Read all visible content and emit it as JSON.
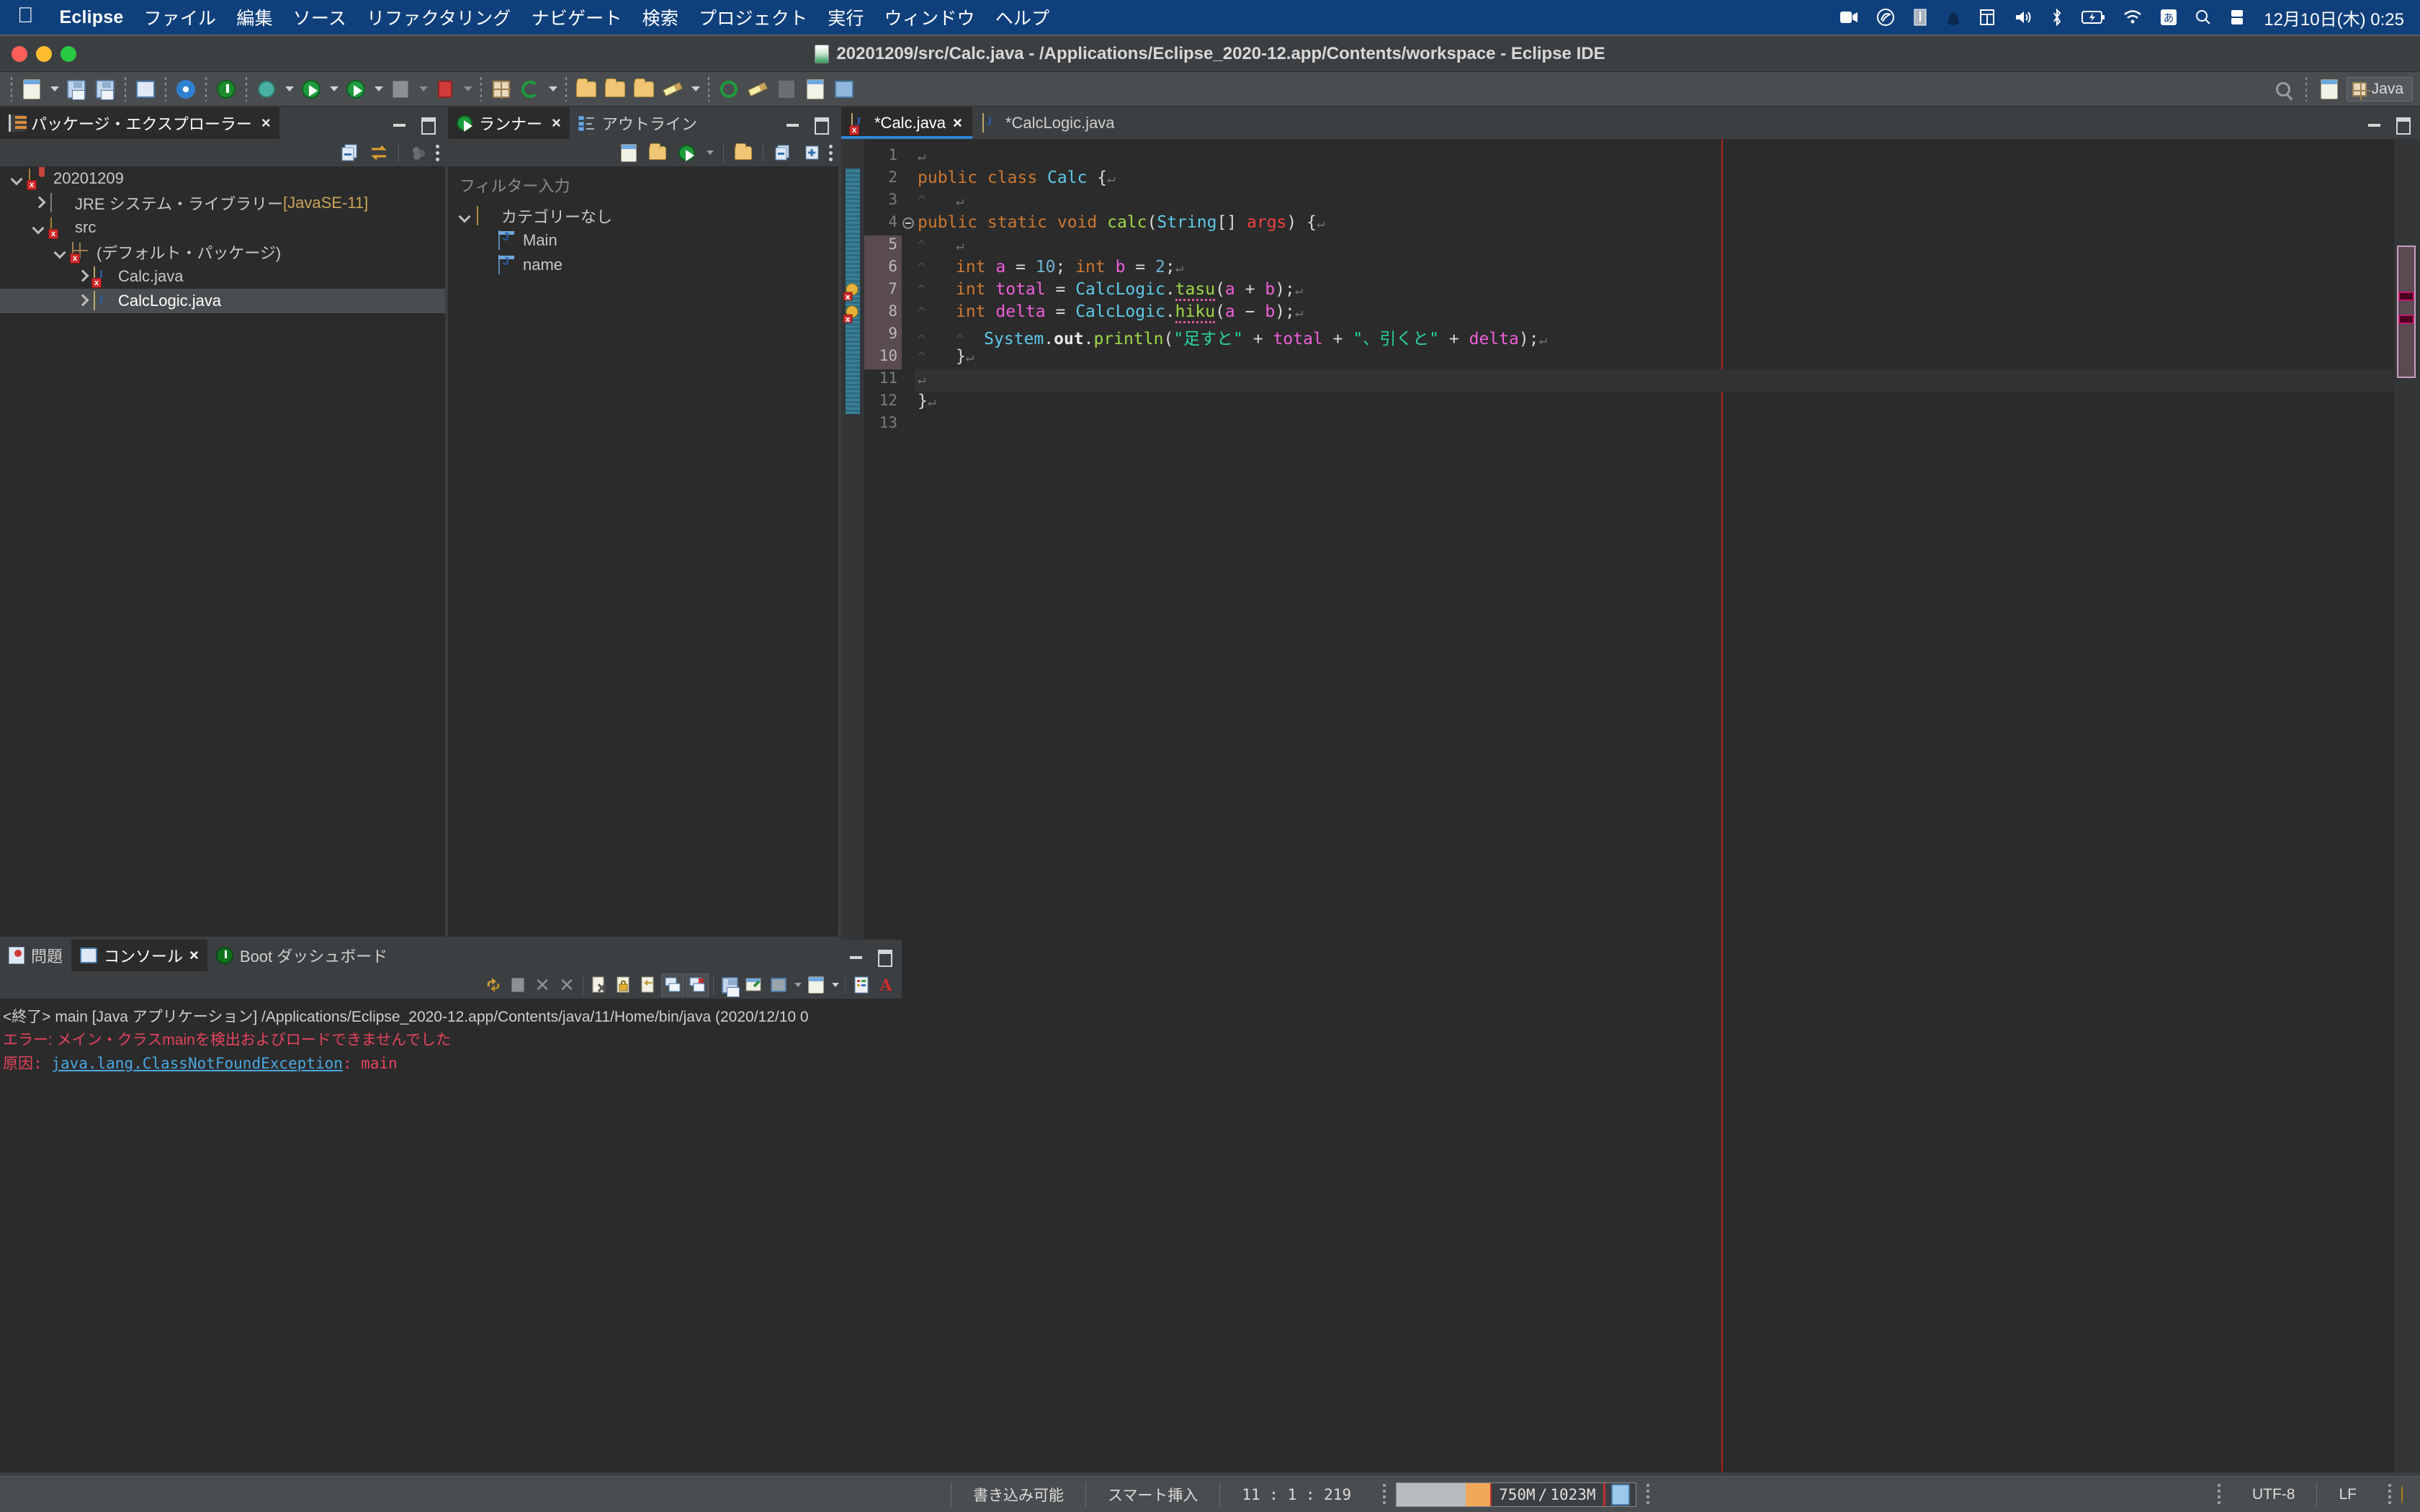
{
  "macbar": {
    "apple_icon": "apple-logo-icon",
    "menus": [
      {
        "label": "Eclipse",
        "bold": true
      },
      {
        "label": "ファイル",
        "bold": false
      },
      {
        "label": "編集",
        "bold": false
      },
      {
        "label": "ソース",
        "bold": false
      },
      {
        "label": "リファクタリング",
        "bold": false
      },
      {
        "label": "ナビゲート",
        "bold": false
      },
      {
        "label": "検索",
        "bold": false
      },
      {
        "label": "プロジェクト",
        "bold": false
      },
      {
        "label": "実行",
        "bold": false
      },
      {
        "label": "ウィンドウ",
        "bold": false
      },
      {
        "label": "ヘルプ",
        "bold": false
      }
    ],
    "tray_icons": [
      "screen-recording-icon",
      "nvidia-icon",
      "display-icon",
      "dropbox-icon",
      "window-manager-icon",
      "volume-icon",
      "bluetooth-icon",
      "battery-charging-icon",
      "wifi-icon",
      "input-method-icon",
      "spotlight-search-icon",
      "control-center-icon"
    ],
    "clock": "12月10日(木) 0:25"
  },
  "window": {
    "title": "20201209/src/Calc.java - /Applications/Eclipse_2020-12.app/Contents/workspace - Eclipse IDE",
    "traffic": {
      "close": "#ff5f57",
      "minimize": "#febc2e",
      "zoom": "#28c840"
    }
  },
  "toolbar": {
    "items": [
      "new-wizard-icon",
      "save-icon",
      "save-all-icon",
      "console-view-icon",
      "build-settings-icon",
      "terminate-power-icon",
      "debug-icon",
      "run-icon",
      "coverage-icon",
      "stop-grey-icon",
      "stop-red-run-icon",
      "new-java-package-icon",
      "new-class-icon",
      "open-type-icon",
      "open-task-icon",
      "open-resource-icon",
      "annotate-pencil-icon",
      "toggle-breakpoint-icon",
      "skip-breakpoints-icon",
      "last-edit-icon",
      "next-annotation-icon",
      "previous-annotation-icon"
    ],
    "search_icon": "search-icon",
    "new-perspective-icon": "open-perspective-icon",
    "perspective": {
      "label": "Java",
      "icon": "java-perspective-icon"
    }
  },
  "package_explorer": {
    "tab": {
      "label": "パッケージ・エクスプローラー",
      "icon": "package-explorer-icon",
      "close": "×",
      "active": true
    },
    "toolbar": [
      "collapse-all-icon",
      "link-with-editor-icon",
      "view-menu-filter-icon",
      "view-menu-icon"
    ],
    "tree": [
      {
        "indent": 0,
        "twist": "down",
        "icon": "java-project-icon",
        "label": "20201209",
        "error": true,
        "selected": false,
        "amber": false
      },
      {
        "indent": 1,
        "twist": "right",
        "icon": "jre-library-icon",
        "label": "JRE システム・ライブラリー ",
        "suffix": "[JavaSE-11]",
        "error": false,
        "selected": false,
        "amber": true
      },
      {
        "indent": 1,
        "twist": "down",
        "icon": "source-folder-icon",
        "label": "src",
        "error": true,
        "selected": false,
        "amber": false
      },
      {
        "indent": 2,
        "twist": "down",
        "icon": "package-icon",
        "label": "(デフォルト・パッケージ)",
        "error": true,
        "selected": false,
        "amber": false
      },
      {
        "indent": 3,
        "twist": "right",
        "icon": "java-file-icon",
        "label": "Calc.java",
        "error": true,
        "selected": false,
        "amber": false
      },
      {
        "indent": 3,
        "twist": "right",
        "icon": "java-file-icon",
        "label": "CalcLogic.java",
        "error": false,
        "selected": true,
        "amber": false
      }
    ]
  },
  "runner_outline": {
    "tabs": [
      {
        "label": "ランナー",
        "icon": "runner-icon",
        "close": "×",
        "active": true
      },
      {
        "label": "アウトライン",
        "icon": "outline-icon",
        "close": "",
        "active": false
      }
    ],
    "toolbar": [
      "new-runner-icon",
      "open-folder-runner-icon",
      "run-icon",
      "run-dropdown-icon",
      "new-folder-icon",
      "collapse-all-icon",
      "expand-all-icon",
      "view-menu-icon"
    ],
    "filter_placeholder": "フィルター入力",
    "tree": [
      {
        "indent": 0,
        "twist": "down",
        "icon": "folder-icon",
        "label": "カテゴリーなし"
      },
      {
        "indent": 1,
        "twist": "none",
        "icon": "java-type-icon",
        "label": "Main"
      },
      {
        "indent": 1,
        "twist": "none",
        "icon": "java-type-icon",
        "label": "name"
      }
    ]
  },
  "editor": {
    "tabs": [
      {
        "label": "*Calc.java",
        "icon": "java-file-error-icon",
        "close": "×",
        "active": true
      },
      {
        "label": "*CalcLogic.java",
        "icon": "java-file-icon",
        "close": "",
        "active": false
      }
    ],
    "minimize_icon": "minimize-icon",
    "maximize_icon": "maximize-icon",
    "line_numbers": [
      "1",
      "2",
      "3",
      "4",
      "5",
      "6",
      "7",
      "8",
      "9",
      "10",
      "11",
      "12",
      "13"
    ],
    "current_line": 11,
    "lines": [
      {
        "n": 1,
        "fold": "",
        "tokens": [
          {
            "t": "↵",
            "c": "nl"
          }
        ]
      },
      {
        "n": 2,
        "fold": "",
        "tokens": [
          {
            "t": "public class ",
            "c": "kw"
          },
          {
            "t": "Calc",
            "c": "cls"
          },
          {
            "t": " {",
            "c": "pln"
          },
          {
            "t": "↵",
            "c": "nl"
          }
        ]
      },
      {
        "n": 3,
        "fold": "",
        "tokens": [
          {
            "t": "^",
            "c": "wsp"
          },
          {
            "t": "   ",
            "c": "pln"
          },
          {
            "t": "↵",
            "c": "nl"
          }
        ]
      },
      {
        "n": 4,
        "fold": "−",
        "tokens": [
          {
            "t": "public static void ",
            "c": "kw"
          },
          {
            "t": "calc",
            "c": "mth"
          },
          {
            "t": "(",
            "c": "pln"
          },
          {
            "t": "String",
            "c": "cls"
          },
          {
            "t": "[] ",
            "c": "pln"
          },
          {
            "t": "args",
            "c": "red"
          },
          {
            "t": ") {",
            "c": "pln"
          },
          {
            "t": "↵",
            "c": "nl"
          }
        ]
      },
      {
        "n": 5,
        "fold": "",
        "tokens": [
          {
            "t": "^",
            "c": "wsp"
          },
          {
            "t": "   ",
            "c": "pln"
          },
          {
            "t": "↵",
            "c": "nl"
          }
        ]
      },
      {
        "n": 6,
        "fold": "",
        "tokens": [
          {
            "t": "^",
            "c": "wsp"
          },
          {
            "t": "   ",
            "c": "pln"
          },
          {
            "t": "int ",
            "c": "kw"
          },
          {
            "t": "a",
            "c": "var"
          },
          {
            "t": " = ",
            "c": "pln"
          },
          {
            "t": "10",
            "c": "num"
          },
          {
            "t": "; ",
            "c": "pln"
          },
          {
            "t": "int ",
            "c": "kw"
          },
          {
            "t": "b",
            "c": "var"
          },
          {
            "t": " = ",
            "c": "pln"
          },
          {
            "t": "2",
            "c": "num"
          },
          {
            "t": ";",
            "c": "pln"
          },
          {
            "t": "↵",
            "c": "nl"
          }
        ]
      },
      {
        "n": 7,
        "fold": "",
        "marker": "error-warning",
        "tokens": [
          {
            "t": "^",
            "c": "wsp"
          },
          {
            "t": "   ",
            "c": "pln"
          },
          {
            "t": "int ",
            "c": "kw"
          },
          {
            "t": "total",
            "c": "var"
          },
          {
            "t": " = ",
            "c": "pln"
          },
          {
            "t": "CalcLogic",
            "c": "cls"
          },
          {
            "t": ".",
            "c": "pln"
          },
          {
            "t": "tasu",
            "c": "mth-err"
          },
          {
            "t": "(",
            "c": "pln"
          },
          {
            "t": "a",
            "c": "var"
          },
          {
            "t": " + ",
            "c": "pln"
          },
          {
            "t": "b",
            "c": "var"
          },
          {
            "t": ");",
            "c": "pln"
          },
          {
            "t": "↵",
            "c": "nl"
          }
        ]
      },
      {
        "n": 8,
        "fold": "",
        "marker": "error-warning",
        "tokens": [
          {
            "t": "^",
            "c": "wsp"
          },
          {
            "t": "   ",
            "c": "pln"
          },
          {
            "t": "int ",
            "c": "kw"
          },
          {
            "t": "delta",
            "c": "var"
          },
          {
            "t": " = ",
            "c": "pln"
          },
          {
            "t": "CalcLogic",
            "c": "cls"
          },
          {
            "t": ".",
            "c": "pln"
          },
          {
            "t": "hiku",
            "c": "mth-err"
          },
          {
            "t": "(",
            "c": "pln"
          },
          {
            "t": "a",
            "c": "var"
          },
          {
            "t": " − ",
            "c": "pln"
          },
          {
            "t": "b",
            "c": "var"
          },
          {
            "t": ");",
            "c": "pln"
          },
          {
            "t": "↵",
            "c": "nl"
          }
        ]
      },
      {
        "n": 9,
        "fold": "",
        "tokens": [
          {
            "t": "^",
            "c": "wsp"
          },
          {
            "t": "   ",
            "c": "pln"
          },
          {
            "t": "^",
            "c": "wsp"
          },
          {
            "t": "  ",
            "c": "pln"
          },
          {
            "t": "System",
            "c": "cls"
          },
          {
            "t": ".",
            "c": "pln"
          },
          {
            "t": "out",
            "c": "fld"
          },
          {
            "t": ".",
            "c": "pln"
          },
          {
            "t": "println",
            "c": "mth"
          },
          {
            "t": "(",
            "c": "pln"
          },
          {
            "t": "\"足すと\"",
            "c": "str"
          },
          {
            "t": " + ",
            "c": "pln"
          },
          {
            "t": "total",
            "c": "var"
          },
          {
            "t": " + ",
            "c": "pln"
          },
          {
            "t": "\"、引くと\"",
            "c": "str"
          },
          {
            "t": " + ",
            "c": "pln"
          },
          {
            "t": "delta",
            "c": "var"
          },
          {
            "t": ");",
            "c": "pln"
          },
          {
            "t": "↵",
            "c": "nl"
          }
        ]
      },
      {
        "n": 10,
        "fold": "",
        "tokens": [
          {
            "t": "^",
            "c": "wsp"
          },
          {
            "t": "   ",
            "c": "pln"
          },
          {
            "t": "}",
            "c": "pln"
          },
          {
            "t": "↵",
            "c": "nl"
          }
        ]
      },
      {
        "n": 11,
        "fold": "",
        "tokens": [
          {
            "t": "↵",
            "c": "nl"
          }
        ]
      },
      {
        "n": 12,
        "fold": "",
        "tokens": [
          {
            "t": "}",
            "c": "pln"
          },
          {
            "t": "↵",
            "c": "nl"
          }
        ]
      },
      {
        "n": 13,
        "fold": "",
        "tokens": []
      }
    ]
  },
  "console": {
    "tabs": [
      {
        "label": "問題",
        "icon": "problems-icon",
        "close": "",
        "active": false
      },
      {
        "label": "コンソール",
        "icon": "console-icon",
        "close": "×",
        "active": true
      },
      {
        "label": "Boot ダッシュボード",
        "icon": "boot-dashboard-icon",
        "close": "",
        "active": false
      }
    ],
    "toolbar": [
      "relaunch-icon",
      "terminate-grey-icon",
      "remove-launch-icon",
      "remove-all-launches-icon",
      "clear-console-icon",
      "lock-scroll-icon",
      "word-wrap-icon",
      "show-console-on-output-icon",
      "show-console-on-error-icon",
      "save-console-icon",
      "pin-console-icon",
      "display-selected-console-icon",
      "open-console-icon",
      "view-menu-icon",
      "link-icon"
    ],
    "lines": [
      {
        "text": "<終了> main [Java アプリケーション] /Applications/Eclipse_2020-12.app/Contents/java/11/Home/bin/java  (2020/12/10 0",
        "class": "plain"
      },
      {
        "text": "エラー: メイン・クラスmainを検出およびロードできませんでした",
        "class": "error"
      },
      {
        "text": "原因: java.lang.ClassNotFoundException: main",
        "class": "error-link",
        "link": "java.lang.ClassNotFoundException",
        "prefix": "原因: ",
        "suffix": ": main"
      }
    ]
  },
  "status": {
    "writable": "書き込み可能",
    "insert_mode": "スマート挿入",
    "position": "11 : 1 : 219",
    "heap_used": "750M",
    "heap_sep": "/",
    "heap_total": "1023M",
    "trash_icon": "garbage-collect-icon",
    "encoding": "UTF-8",
    "line_delim": "LF",
    "tip_icon": "quick-tip-bulb-icon"
  }
}
